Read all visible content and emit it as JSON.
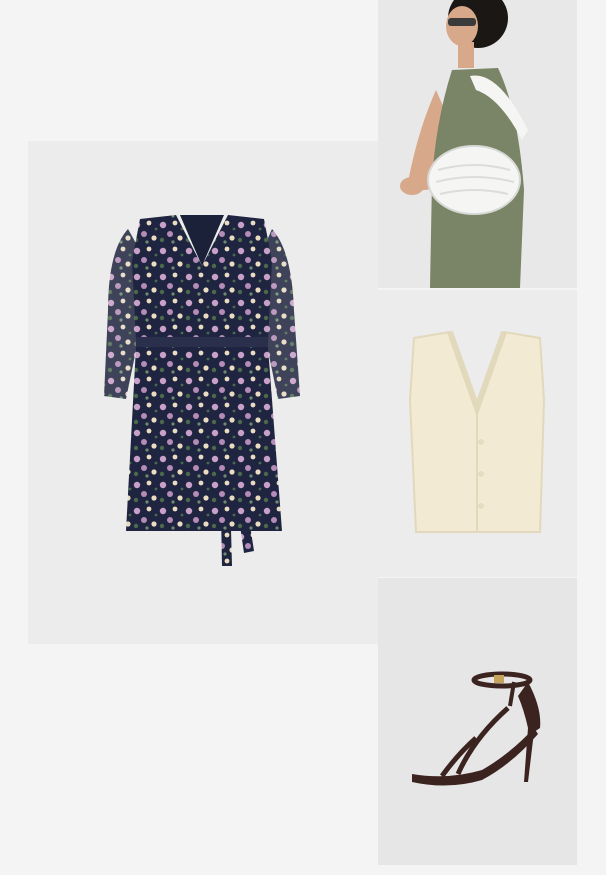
{
  "outfit": {
    "items": [
      {
        "id": "dress",
        "icon": "floral-dress-image",
        "colors": {
          "base": "#1f2540",
          "flower_pink": "#c9a0c8",
          "flower_cream": "#e9dcc0",
          "leaf": "#4b6a4c"
        }
      },
      {
        "id": "bag",
        "icon": "model-with-white-bag-image",
        "colors": {
          "dress": "#7a8466",
          "bag": "#f5f5f3",
          "skin": "#d7a98a",
          "hair": "#1b1714"
        }
      },
      {
        "id": "vest",
        "icon": "cream-knit-vest-image",
        "colors": {
          "knit": "#f2ead2"
        }
      },
      {
        "id": "sandal",
        "icon": "strappy-heeled-sandal-image",
        "colors": {
          "leather": "#3b2320",
          "buckle": "#c6a35a"
        }
      }
    ]
  }
}
